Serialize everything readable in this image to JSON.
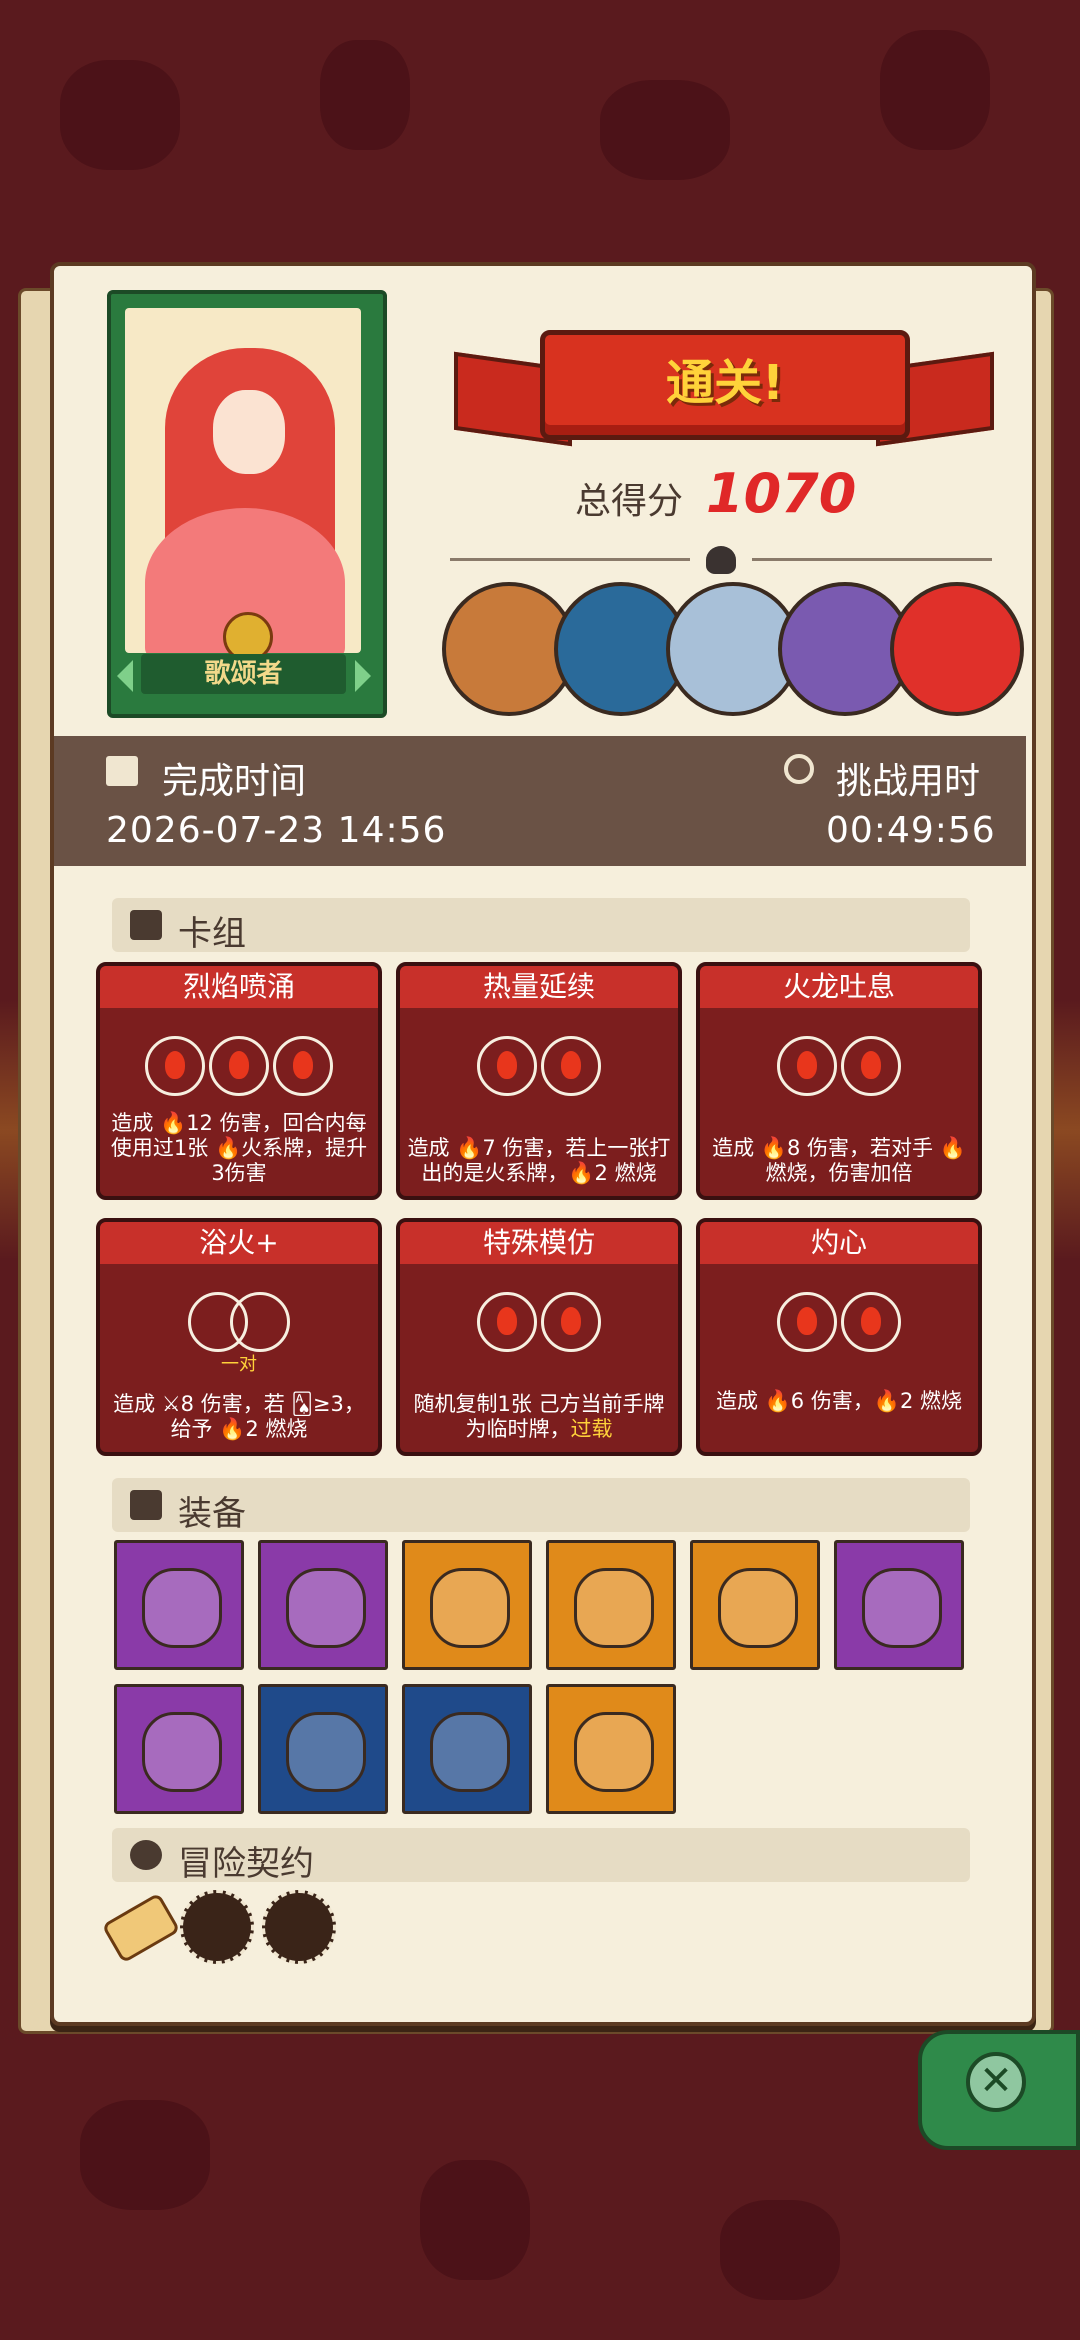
{
  "hero": {
    "name": "歌颂者"
  },
  "banner": {
    "title": "通关!"
  },
  "score": {
    "label": "总得分",
    "value": "1070"
  },
  "bosses": [
    {
      "icon": "boss-cyclops-icon",
      "color": "#c87a3a"
    },
    {
      "icon": "boss-shadow-icon",
      "color": "#2a6a9a"
    },
    {
      "icon": "boss-beast-icon",
      "color": "#a8c0d8"
    },
    {
      "icon": "boss-dragon-icon",
      "color": "#7a5ab0"
    },
    {
      "icon": "boss-spirit-icon",
      "color": "#e0302a"
    }
  ],
  "time": {
    "completed_label": "完成时间",
    "completed_value": "2026-07-23 14:56",
    "duration_label": "挑战用时",
    "duration_value": "00:49:56"
  },
  "deck": {
    "title": "卡组",
    "cards": [
      {
        "name": "烈焰喷涌",
        "desc": "造成 🔥12 伤害，回合内每使用过1张 🔥火系牌，提升3伤害"
      },
      {
        "name": "热量延续",
        "desc": "造成 🔥7 伤害，若上一张打出的是火系牌，🔥2 燃烧"
      },
      {
        "name": "火龙吐息",
        "desc": "造成 🔥8 伤害，若对手 🔥燃烧，伤害加倍"
      },
      {
        "name": "浴火+",
        "desc": "造成 ⚔8 伤害，若 🂡≥3，给予 🔥2 燃烧",
        "orb_label": "一对"
      },
      {
        "name": "特殊模仿",
        "desc": "随机复制1张 己方当前手牌为临时牌，",
        "keyword": "过载"
      },
      {
        "name": "灼心",
        "desc": "造成 🔥6 伤害，🔥2 燃烧"
      }
    ]
  },
  "equipment": {
    "title": "装备",
    "items": [
      {
        "icon": "fire-pepper-icon",
        "bg": "#8a3aa8"
      },
      {
        "icon": "golden-chalice-icon",
        "bg": "#8a3aa8"
      },
      {
        "icon": "turtle-shell-icon",
        "bg": "#e08a1a"
      },
      {
        "icon": "ghost-slime-icon",
        "bg": "#e08a1a"
      },
      {
        "icon": "hood-icon",
        "bg": "#e08a1a"
      },
      {
        "icon": "flame-icon",
        "bg": "#8a3aa8"
      },
      {
        "icon": "leather-band-icon",
        "bg": "#8a3aa8"
      },
      {
        "icon": "torch-icon",
        "bg": "#1f4a8a"
      },
      {
        "icon": "golden-helmet-icon",
        "bg": "#1f4a8a"
      },
      {
        "icon": "fire-orb-icon",
        "bg": "#e08a1a"
      }
    ]
  },
  "contracts": {
    "title": "冒险契约",
    "items": [
      {
        "icon": "scroll-icon"
      },
      {
        "icon": "pipe-icon"
      },
      {
        "icon": "scroll-case-icon"
      }
    ]
  }
}
